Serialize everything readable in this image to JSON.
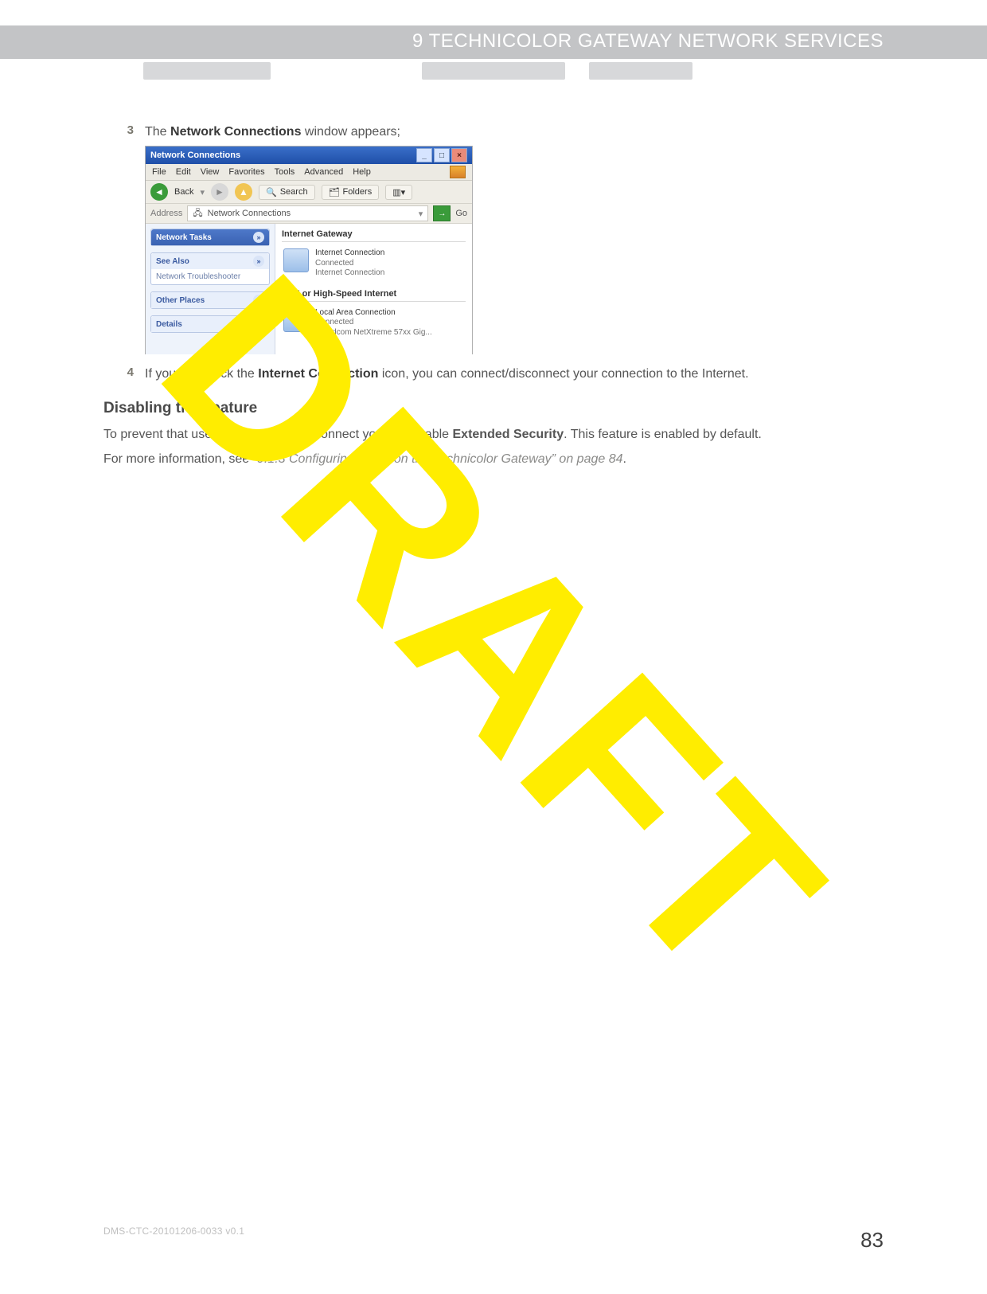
{
  "header": {
    "title": "9 TECHNICOLOR GATEWAY NETWORK SERVICES"
  },
  "watermark": "DRAFT",
  "footer": {
    "doc_id": "DMS-CTC-20101206-0033 v0.1",
    "page_number": "83"
  },
  "steps": {
    "s3": {
      "num": "3",
      "pre": "The ",
      "bold": "Network Connections",
      "post": " window appears;"
    },
    "s4": {
      "num": "4",
      "pre": "If you right-click the ",
      "bold": "Internet Connection",
      "post": " icon, you can connect/disconnect your connection to the Internet."
    }
  },
  "section": {
    "heading": "Disabling this feature",
    "p1_pre": "To prevent that users can connect/disconnect you can enable ",
    "p1_bold": "Extended Security",
    "p1_post": ". This feature is enabled by default.",
    "p2_pre": "For more information, see ",
    "p2_ref": "“9.1.3 Configuring UPnP on the Technicolor Gateway” on page 84",
    "p2_post": "."
  },
  "screenshot": {
    "window_title": "Network Connections",
    "win_buttons": {
      "min": "_",
      "max": "□",
      "close": "×"
    },
    "menubar": [
      "File",
      "Edit",
      "View",
      "Favorites",
      "Tools",
      "Advanced",
      "Help"
    ],
    "toolbar": {
      "back": "Back",
      "search": "Search",
      "folders": "Folders"
    },
    "address": {
      "label": "Address",
      "value": "Network Connections",
      "go": "Go"
    },
    "side_panels": {
      "tasks": "Network Tasks",
      "see_also": "See Also",
      "see_also_item": "Network Troubleshooter",
      "other": "Other Places",
      "details": "Details"
    },
    "groups": {
      "g1": {
        "header": "Internet Gateway",
        "title": "Internet Connection",
        "line2": "Connected",
        "line3": "Internet Connection"
      },
      "g2": {
        "header": "LAN or High-Speed Internet",
        "title": "Local Area Connection",
        "line2": "Connected",
        "line3": "Broadcom NetXtreme 57xx Gig..."
      }
    }
  }
}
